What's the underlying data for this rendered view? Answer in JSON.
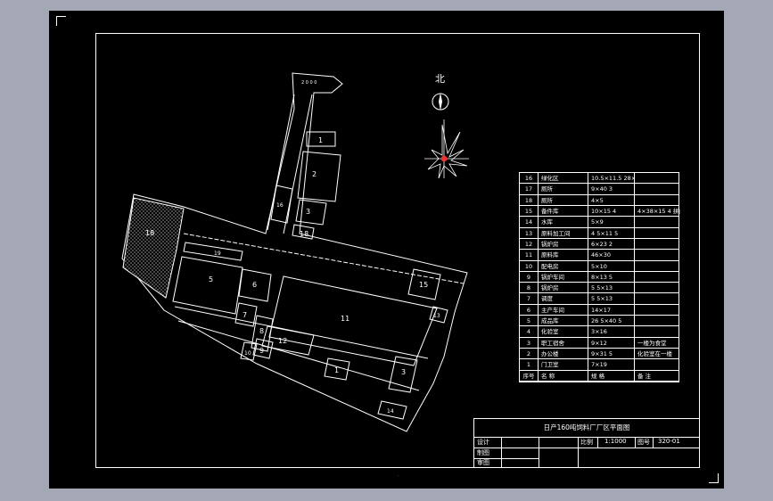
{
  "north_label": "北",
  "plan_labels": {
    "top_box": "2 0 0 0",
    "b1": "1",
    "b2": "2",
    "b3": "3",
    "b5": "5",
    "b6": "6",
    "b7": "7",
    "b8": "8",
    "b9": "9",
    "b10": "10",
    "b11": "11",
    "b12": "12",
    "b13": "13",
    "b14": "14",
    "b15": "15",
    "b16": "16",
    "b18": "18",
    "b19": "19"
  },
  "schedule": {
    "headers": [
      "序号",
      "名 称",
      "规 格",
      "备 注"
    ],
    "rows": [
      {
        "no": "16",
        "name": "绿化区",
        "spec": "10.5×11.5 28×45",
        "note": ""
      },
      {
        "no": "17",
        "name": "厕所",
        "spec": "9×40 3",
        "note": ""
      },
      {
        "no": "18",
        "name": "厕所",
        "spec": "4×5",
        "note": ""
      },
      {
        "no": "15",
        "name": "备件库",
        "spec": "10×15 4",
        "note": "4×38×15 4 拼合"
      },
      {
        "no": "14",
        "name": "水库",
        "spec": "5×9",
        "note": ""
      },
      {
        "no": "13",
        "name": "原料加工间",
        "spec": "4 5×11 5",
        "note": ""
      },
      {
        "no": "12",
        "name": "锅炉房",
        "spec": "6×23 2",
        "note": ""
      },
      {
        "no": "11",
        "name": "原料库",
        "spec": "46×30",
        "note": ""
      },
      {
        "no": "10",
        "name": "配电房",
        "spec": "5×10",
        "note": ""
      },
      {
        "no": "9",
        "name": "锅炉车间",
        "spec": "8×13 5",
        "note": ""
      },
      {
        "no": "8",
        "name": "锅炉房",
        "spec": "5 5×13",
        "note": ""
      },
      {
        "no": "7",
        "name": "调度",
        "spec": "5 5×13",
        "note": ""
      },
      {
        "no": "6",
        "name": "主产车间",
        "spec": "14×17",
        "note": ""
      },
      {
        "no": "5",
        "name": "成品库",
        "spec": "26 5×40 5",
        "note": ""
      },
      {
        "no": "4",
        "name": "化验室",
        "spec": "3×16",
        "note": ""
      },
      {
        "no": "3",
        "name": "职工宿舍",
        "spec": "9×12",
        "note": "一楼为食堂"
      },
      {
        "no": "2",
        "name": "办公楼",
        "spec": "9×31 5",
        "note": "化验室在一楼"
      },
      {
        "no": "1",
        "name": "门卫室",
        "spec": "7×19",
        "note": ""
      }
    ]
  },
  "title_block": {
    "title": "日产160吨饲料厂厂区平面图",
    "design": "设计",
    "draw": "制图",
    "review": "审图",
    "scale_label": "比例",
    "scale_value": "1:1000",
    "drawing_no_label": "图号",
    "drawing_no": "320-01"
  },
  "colors": {
    "background": "#000000",
    "lines": "#ffffff",
    "outer": "#a3a8b4"
  }
}
